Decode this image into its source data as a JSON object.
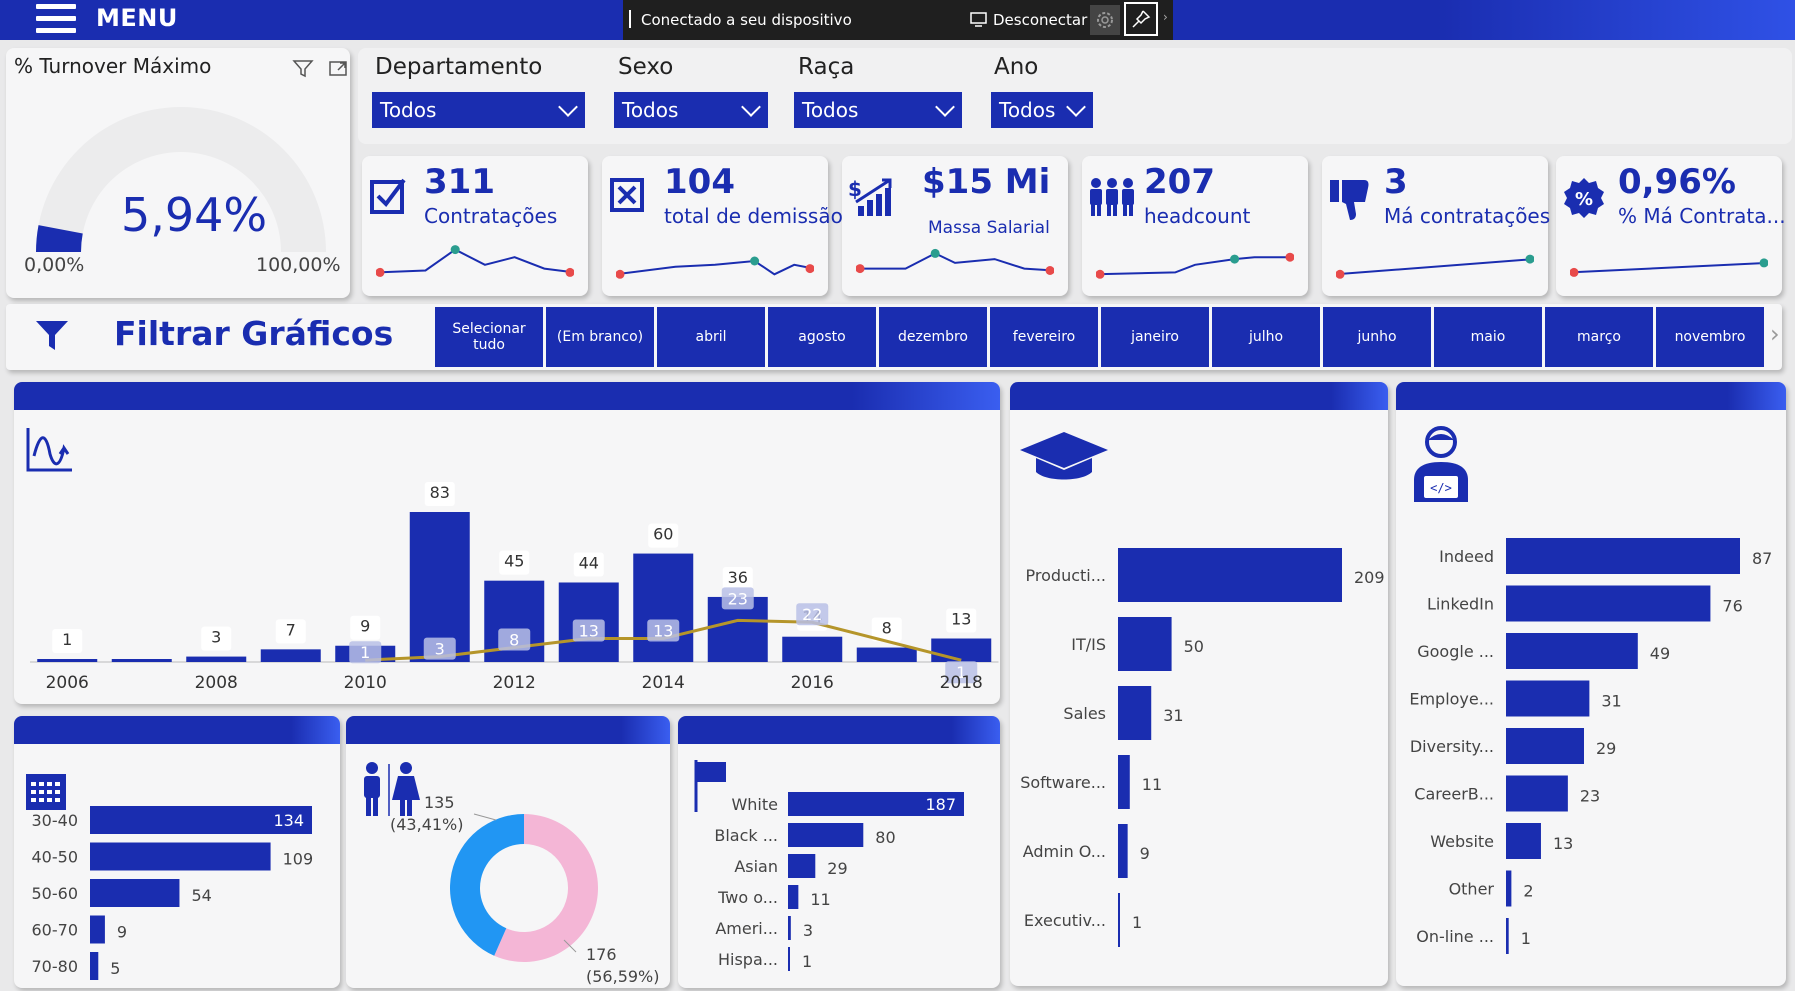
{
  "topbar": {
    "menu": "MENU",
    "connection": "Conectado a seu dispositivo",
    "disconnect": "Desconectar"
  },
  "gauge": {
    "title": "% Turnover Máximo",
    "value": "5,94%",
    "min": "0,00%",
    "max": "100,00%",
    "fraction": 0.0594
  },
  "filters": [
    {
      "label": "Departamento",
      "value": "Todos"
    },
    {
      "label": "Sexo",
      "value": "Todos"
    },
    {
      "label": "Raça",
      "value": "Todos"
    },
    {
      "label": "Ano",
      "value": "Todos"
    }
  ],
  "kpis": [
    {
      "value": "311",
      "label": "Contratações",
      "icon": "checkbox-icon"
    },
    {
      "value": "104",
      "label": "total de demissão",
      "icon": "x-box-icon"
    },
    {
      "value": "$15 Mi",
      "label": "Massa Salarial",
      "icon": "rising-chart-icon"
    },
    {
      "value": "207",
      "label": "headcount",
      "icon": "people-icon"
    },
    {
      "value": "3",
      "label": "Má contratações",
      "icon": "thumbs-down-icon"
    },
    {
      "value": "0,96%",
      "label": "% Má Contrata...",
      "icon": "percent-badge-icon"
    }
  ],
  "chart_filter": {
    "title": "Filtrar Gráficos",
    "buttons": [
      "Selecionar tudo",
      "(Em branco)",
      "abril",
      "agosto",
      "dezembro",
      "fevereiro",
      "janeiro",
      "julho",
      "junho",
      "maio",
      "março",
      "novembro"
    ]
  },
  "colors": {
    "primary": "#1a2db0",
    "line": "#b5952a",
    "pink": "#f4b6d6",
    "blue": "#2196f3",
    "red": "#e84a4a",
    "teal": "#2a9d8f"
  },
  "chart_data": [
    {
      "type": "bar",
      "name": "hires-vs-terminations-by-year",
      "categories": [
        "2006",
        "2007",
        "2008",
        "2009",
        "2010",
        "2011",
        "2012",
        "2013",
        "2014",
        "2015",
        "2016",
        "2017",
        "2018"
      ],
      "x_tick_labels": [
        "2006",
        "2008",
        "2010",
        "2012",
        "2014",
        "2016",
        "2018"
      ],
      "series": [
        {
          "values": [
            1,
            null,
            3,
            7,
            9,
            83,
            45,
            44,
            60,
            36,
            14,
            8,
            13
          ]
        },
        {
          "type": "line",
          "values": [
            null,
            null,
            null,
            null,
            1,
            3,
            8,
            13,
            13,
            23,
            22,
            null,
            1
          ]
        }
      ]
    },
    {
      "type": "bar",
      "orientation": "horizontal",
      "name": "department",
      "categories": [
        "Producti...",
        "IT/IS",
        "Sales",
        "Software...",
        "Admin O...",
        "Executiv..."
      ],
      "values": [
        209,
        50,
        31,
        11,
        9,
        1
      ]
    },
    {
      "type": "bar",
      "orientation": "horizontal",
      "name": "recruitment-source",
      "categories": [
        "Indeed",
        "LinkedIn",
        "Google ...",
        "Employe...",
        "Diversity...",
        "CareerB...",
        "Website",
        "Other",
        "On-line ..."
      ],
      "values": [
        87,
        76,
        49,
        31,
        29,
        23,
        13,
        2,
        1
      ]
    },
    {
      "type": "bar",
      "orientation": "horizontal",
      "name": "age",
      "categories": [
        "30-40",
        "40-50",
        "50-60",
        "60-70",
        "70-80"
      ],
      "values": [
        134,
        109,
        54,
        9,
        5
      ]
    },
    {
      "type": "pie",
      "name": "sex",
      "values": [
        135,
        176
      ],
      "labels": [
        "135",
        "176"
      ],
      "pct_labels": [
        "(43,41%)",
        "(56,59%)"
      ]
    },
    {
      "type": "bar",
      "orientation": "horizontal",
      "name": "race",
      "categories": [
        "White",
        "Black ...",
        "Asian",
        "Two o...",
        "Ameri...",
        "Hispa..."
      ],
      "values": [
        187,
        80,
        29,
        11,
        3,
        1
      ]
    }
  ]
}
